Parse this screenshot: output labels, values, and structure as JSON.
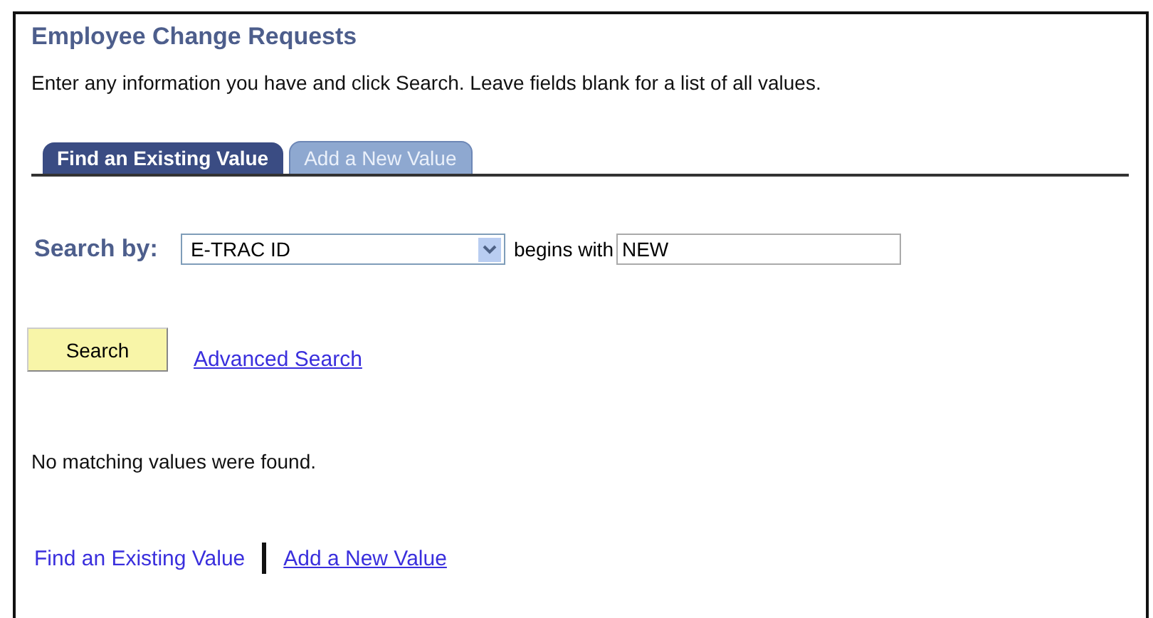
{
  "page": {
    "title": "Employee Change Requests",
    "instructions": "Enter any information you have and click Search. Leave fields blank for a list of all values."
  },
  "tabs": [
    {
      "label": "Find an Existing Value",
      "selected": true
    },
    {
      "label": "Add a New Value",
      "selected": false
    }
  ],
  "search": {
    "label": "Search by:",
    "field": "E-TRAC ID",
    "operator": "begins with",
    "value": "NEW",
    "button": "Search",
    "advanced_link": "Advanced Search"
  },
  "message": "No matching values were found.",
  "footer_links": [
    {
      "label": "Find an Existing Value",
      "selected": true
    },
    {
      "label": "Add a New Value",
      "selected": false
    }
  ]
}
